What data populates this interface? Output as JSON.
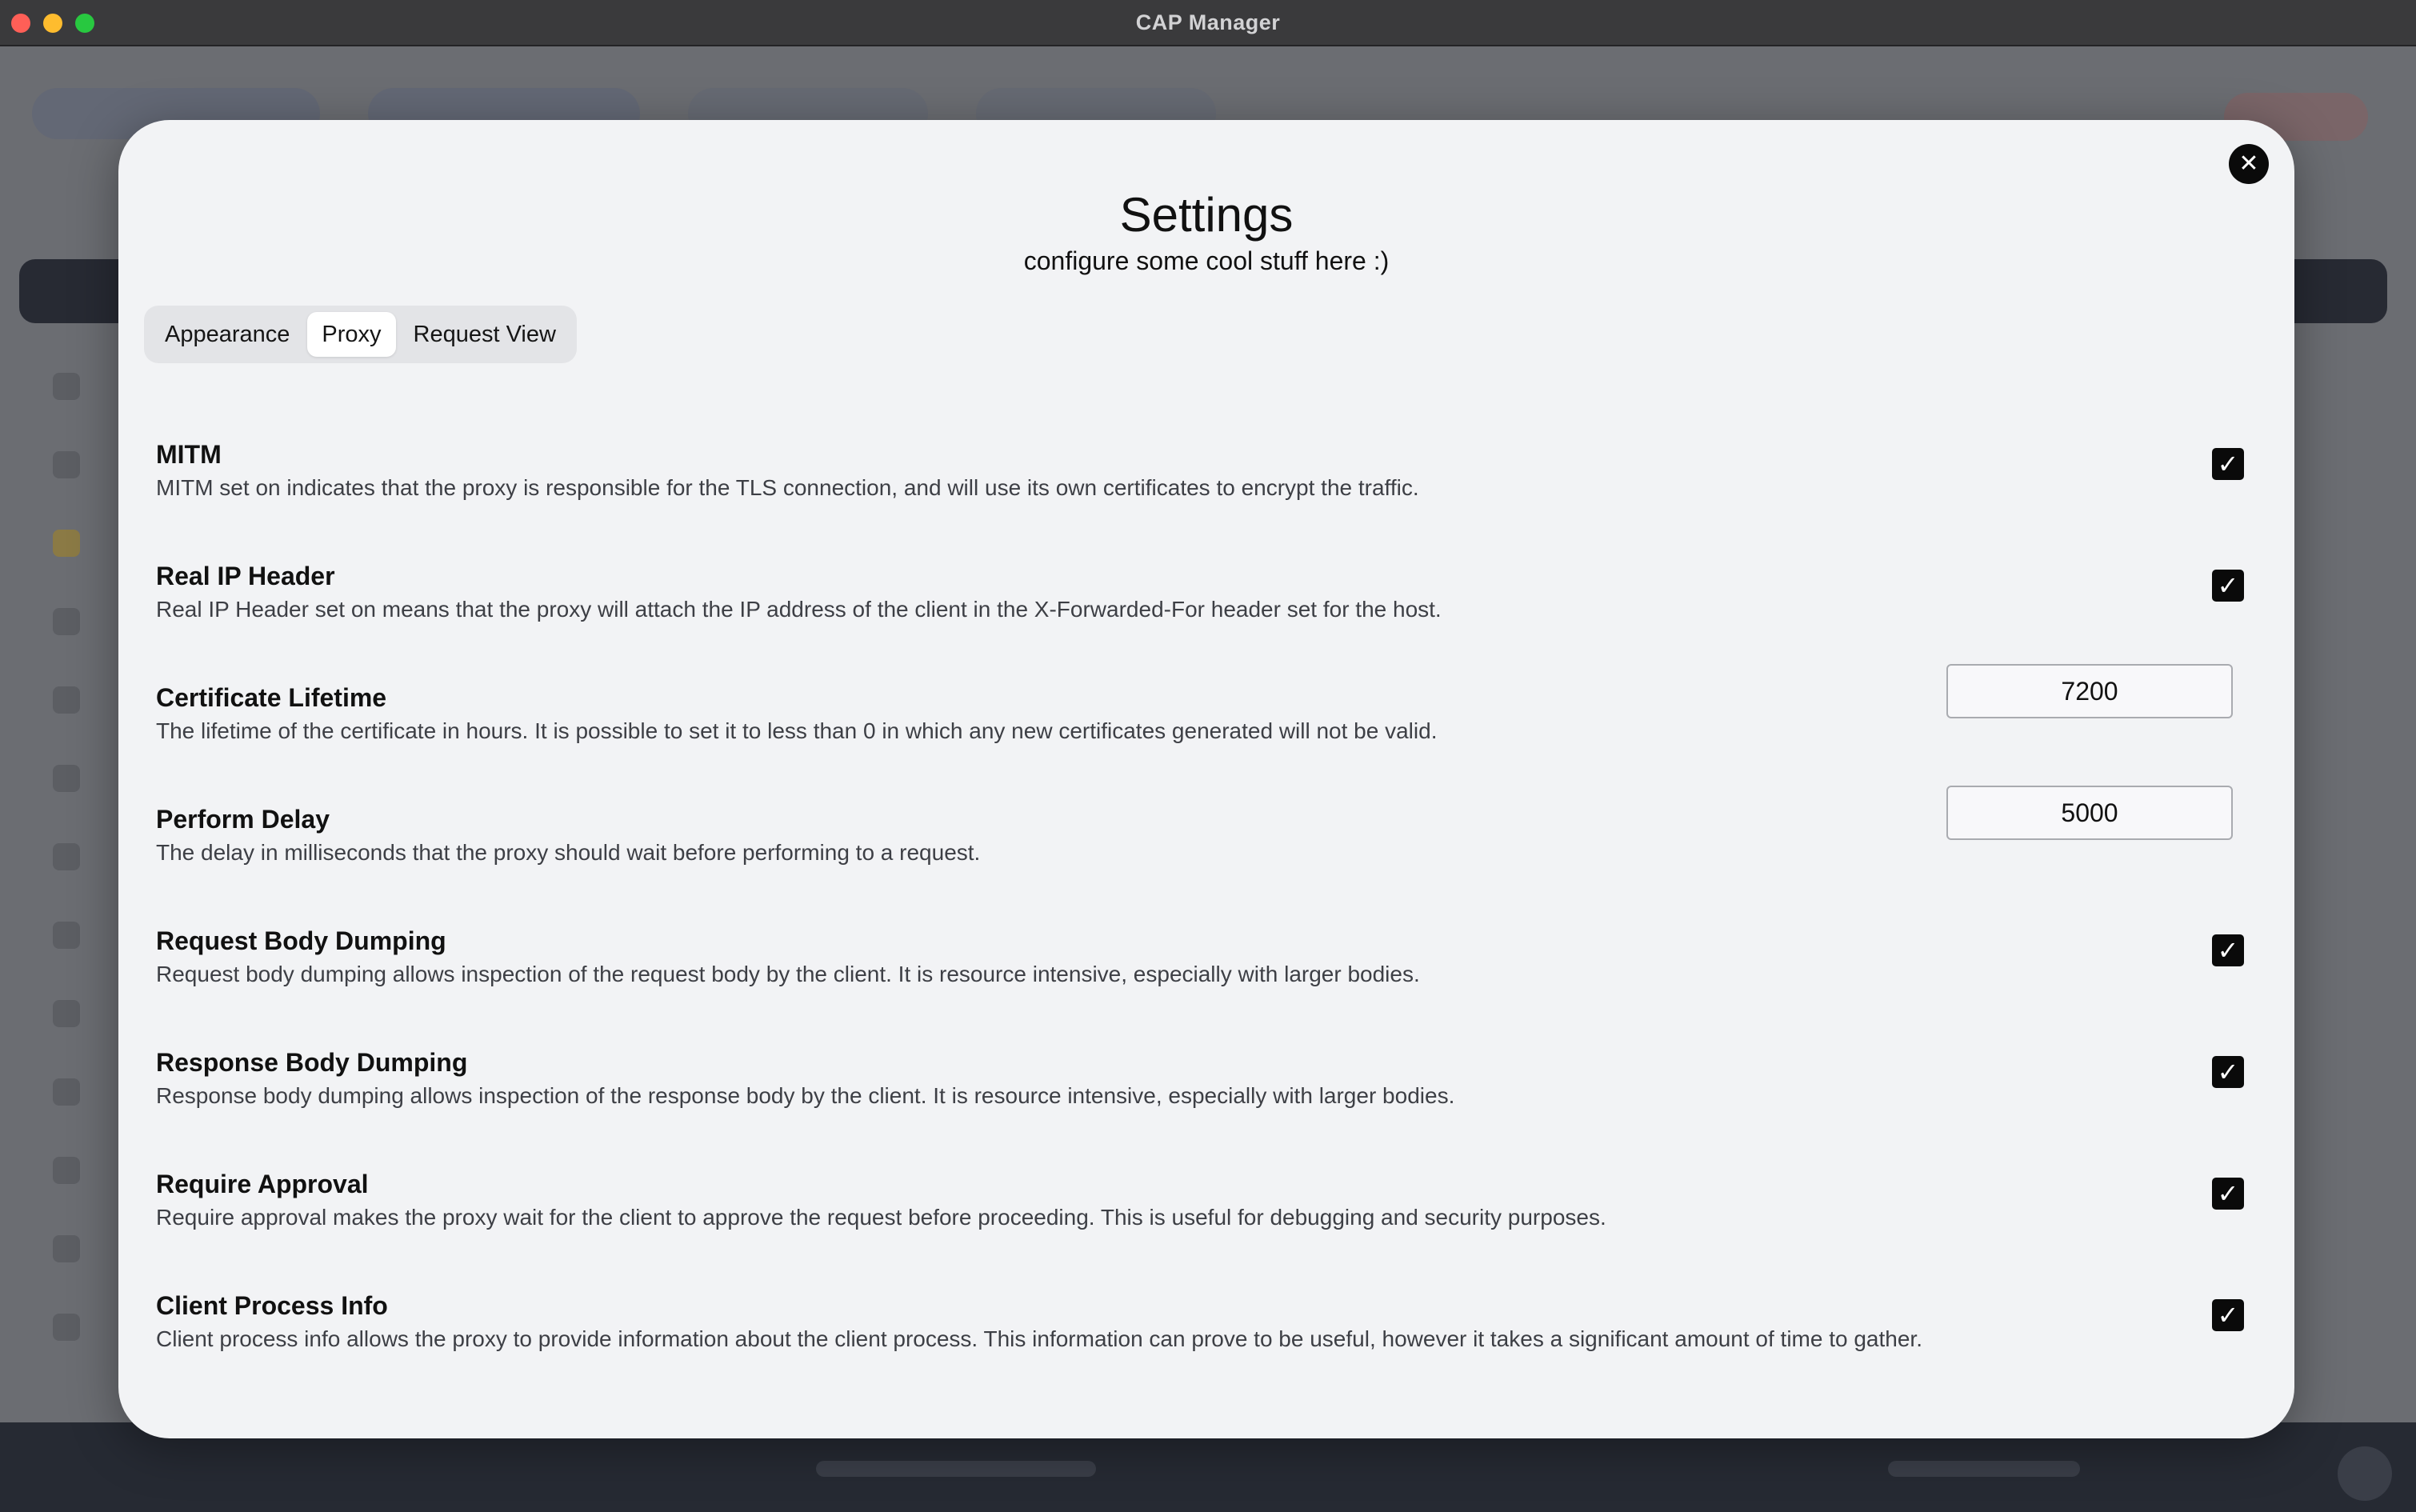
{
  "window": {
    "title": "CAP Manager"
  },
  "modal": {
    "title": "Settings",
    "subtitle": "configure some cool stuff here :)",
    "close_icon": "close-icon",
    "tabs": [
      {
        "label": "Appearance",
        "active": false
      },
      {
        "label": "Proxy",
        "active": true
      },
      {
        "label": "Request View",
        "active": false
      }
    ]
  },
  "settings": [
    {
      "title": "MITM",
      "description": "MITM set on indicates that the proxy is responsible for the TLS connection, and will use its own certificates to encrypt the traffic.",
      "control": "checkbox",
      "checked": true
    },
    {
      "title": "Real IP Header",
      "description": "Real IP Header set on means that the proxy will attach the IP address of the client in the X-Forwarded-For header set for the host.",
      "control": "checkbox",
      "checked": true
    },
    {
      "title": "Certificate Lifetime",
      "description": "The lifetime of the certificate in hours. It is possible to set it to less than 0 in which any new certificates generated will not be valid.",
      "control": "number",
      "value": "7200"
    },
    {
      "title": "Perform Delay",
      "description": "The delay in milliseconds that the proxy should wait before performing to a request.",
      "control": "number",
      "value": "5000"
    },
    {
      "title": "Request Body Dumping",
      "description": "Request body dumping allows inspection of the request body by the client. It is resource intensive, especially with larger bodies.",
      "control": "checkbox",
      "checked": true
    },
    {
      "title": "Response Body Dumping",
      "description": "Response body dumping allows inspection of the response body by the client. It is resource intensive, especially with larger bodies.",
      "control": "checkbox",
      "checked": true
    },
    {
      "title": "Require Approval",
      "description": "Require approval makes the proxy wait for the client to approve the request before proceeding. This is useful for debugging and security purposes.",
      "control": "checkbox",
      "checked": true
    },
    {
      "title": "Client Process Info",
      "description": "Client process info allows the proxy to provide information about the client process. This information can prove to be useful, however it takes a significant amount of time to gather.",
      "control": "checkbox",
      "checked": true
    }
  ],
  "colors": {
    "modal_bg": "#f2f3f5",
    "accent": "#0a0a0a",
    "tab_bar_bg": "#e3e4e7"
  }
}
